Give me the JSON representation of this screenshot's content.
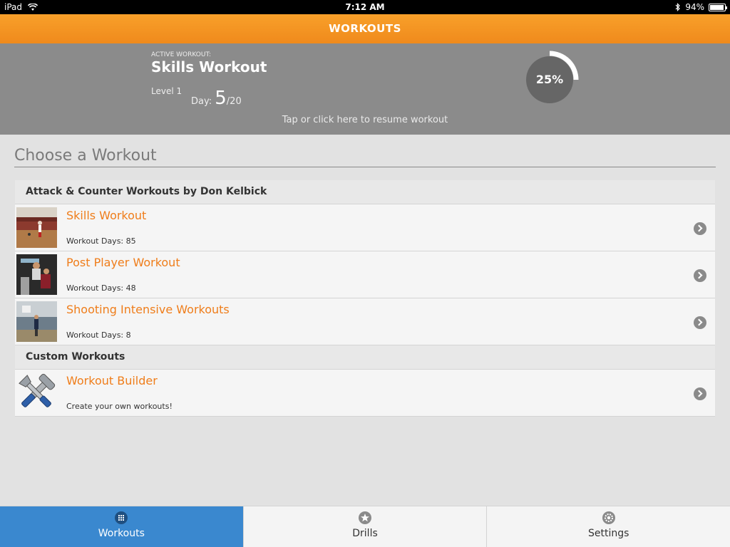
{
  "status_bar": {
    "device": "iPad",
    "time": "7:12 AM",
    "battery": "94%",
    "battery_level": 0.94
  },
  "header": {
    "title": "WORKOUTS"
  },
  "active_workout": {
    "label": "ACTIVE WORKOUT:",
    "title": "Skills Workout",
    "level": "Level 1",
    "day_label": "Day:",
    "day_current": "5",
    "day_total": "/20",
    "progress_text": "25%",
    "progress_value": 0.25,
    "resume_text": "Tap or click here to resume workout"
  },
  "main": {
    "heading": "Choose a Workout",
    "groups": [
      {
        "header": "Attack & Counter Workouts by Don Kelbick",
        "items": [
          {
            "title": "Skills Workout",
            "subtitle": "Workout Days: 85"
          },
          {
            "title": "Post Player Workout",
            "subtitle": "Workout Days: 48"
          },
          {
            "title": "Shooting Intensive Workouts",
            "subtitle": "Workout Days: 8"
          }
        ]
      },
      {
        "header": "Custom Workouts",
        "items": [
          {
            "title": "Workout Builder",
            "subtitle": "Create your own workouts!"
          }
        ]
      }
    ]
  },
  "tabs": [
    {
      "label": "Workouts",
      "icon": "grid-icon",
      "active": true
    },
    {
      "label": "Drills",
      "icon": "star-icon",
      "active": false
    },
    {
      "label": "Settings",
      "icon": "gear-icon",
      "active": false
    }
  ],
  "colors": {
    "accent_orange": "#ef7d1a",
    "header_orange": "#f5951f",
    "active_panel": "#8b8b8b",
    "tab_active": "#3a88cf"
  }
}
